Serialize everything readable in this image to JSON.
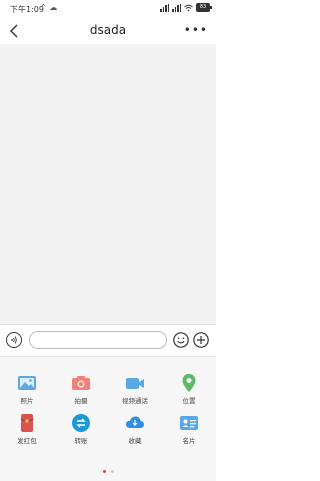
{
  "status_bar": {
    "time": "下午1:09",
    "battery": "83"
  },
  "header": {
    "title": "dsada",
    "more": "•••"
  },
  "input": {
    "value": "",
    "placeholder": ""
  },
  "panel": {
    "items": [
      {
        "label": "照片",
        "icon": "photo-icon",
        "color": "#5aa9e6"
      },
      {
        "label": "拍摄",
        "icon": "camera-icon",
        "color": "#f0827a"
      },
      {
        "label": "视频通话",
        "icon": "video-call-icon",
        "color": "#5aa9e6"
      },
      {
        "label": "位置",
        "icon": "location-icon",
        "color": "#5cba6a"
      },
      {
        "label": "发红包",
        "icon": "red-packet-icon",
        "color": "#d9534f"
      },
      {
        "label": "转账",
        "icon": "transfer-icon",
        "color": "#1c9ad6"
      },
      {
        "label": "收藏",
        "icon": "favorites-icon",
        "color": "#2f8ee5"
      },
      {
        "label": "名片",
        "icon": "contact-card-icon",
        "color": "#5aa9e6"
      }
    ],
    "page_count": 2,
    "active_page": 1
  }
}
